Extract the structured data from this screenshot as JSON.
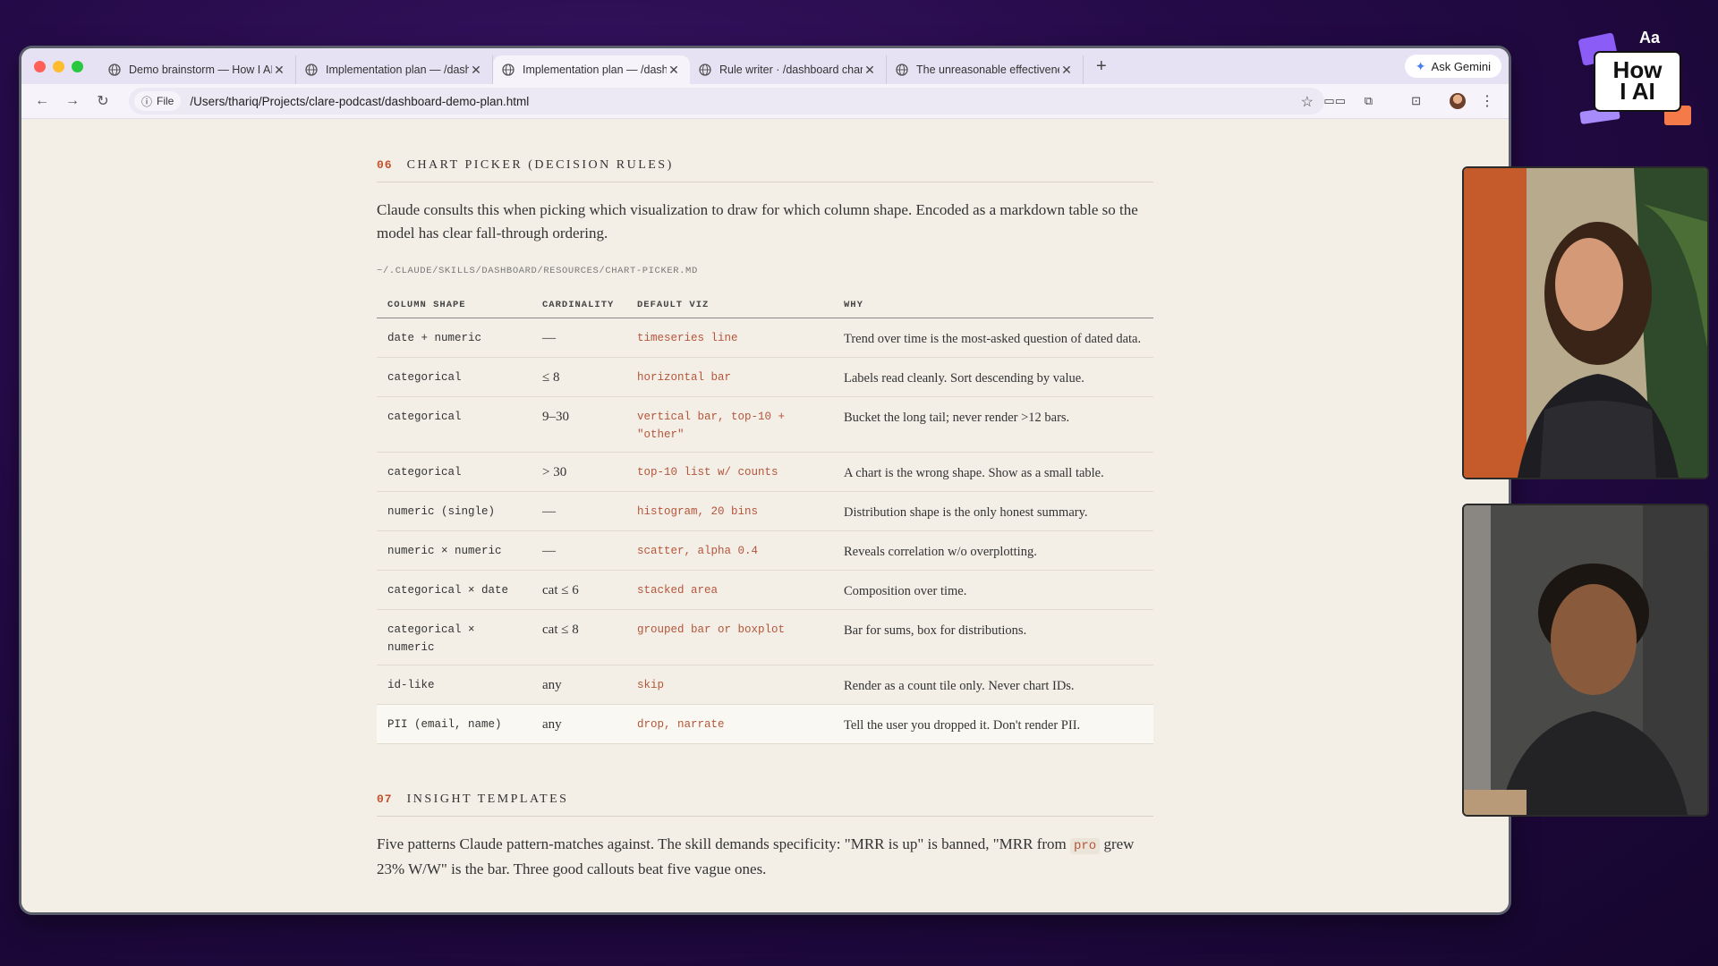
{
  "browser": {
    "tabs": [
      {
        "label": "Demo brainstorm — How I AI",
        "active": false
      },
      {
        "label": "Implementation plan — /dashboard",
        "active": false
      },
      {
        "label": "Implementation plan — /dashboard",
        "active": true
      },
      {
        "label": "Rule writer · /dashboard chart",
        "active": false
      },
      {
        "label": "The unreasonable effectiveness",
        "active": false
      }
    ],
    "new_tab": "+",
    "gemini_label": "Ask Gemini",
    "file_chip": "File",
    "url": "/Users/thariq/Projects/clare-podcast/dashboard-demo-plan.html"
  },
  "section6": {
    "number": "06",
    "title": "CHART PICKER (DECISION RULES)",
    "intro": "Claude consults this when picking which visualization to draw for which column shape. Encoded as a markdown table so the model has clear fall-through ordering.",
    "path": "~/.CLAUDE/SKILLS/DASHBOARD/RESOURCES/CHART-PICKER.MD",
    "headers": {
      "shape": "COLUMN SHAPE",
      "card": "CARDINALITY",
      "viz": "DEFAULT VIZ",
      "why": "WHY"
    },
    "rows": [
      {
        "shape": "date + numeric",
        "card": "—",
        "viz": "timeseries line",
        "why": "Trend over time is the most-asked question of dated data."
      },
      {
        "shape": "categorical",
        "card": "≤ 8",
        "viz": "horizontal bar",
        "why": "Labels read cleanly. Sort descending by value."
      },
      {
        "shape": "categorical",
        "card": "9–30",
        "viz": "vertical bar, top-10 + \"other\"",
        "why": "Bucket the long tail; never render >12 bars."
      },
      {
        "shape": "categorical",
        "card": "> 30",
        "viz": "top-10 list w/ counts",
        "why": "A chart is the wrong shape. Show as a small table."
      },
      {
        "shape": "numeric (single)",
        "card": "—",
        "viz": "histogram, 20 bins",
        "why": "Distribution shape is the only honest summary."
      },
      {
        "shape": "numeric × numeric",
        "card": "—",
        "viz": "scatter, alpha 0.4",
        "why": "Reveals correlation w/o overplotting."
      },
      {
        "shape": "categorical × date",
        "card": "cat ≤ 6",
        "viz": "stacked area",
        "why": "Composition over time."
      },
      {
        "shape": "categorical × numeric",
        "card": "cat ≤ 8",
        "viz": "grouped bar or boxplot",
        "why": "Bar for sums, box for distributions."
      },
      {
        "shape": "id-like",
        "card": "any",
        "viz": "skip",
        "why": "Render as a count tile only. Never chart IDs."
      },
      {
        "shape": "PII (email, name)",
        "card": "any",
        "viz": "drop, narrate",
        "why": "Tell the user you dropped it. Don't render PII."
      }
    ]
  },
  "section7": {
    "number": "07",
    "title": "INSIGHT TEMPLATES",
    "intro_a": "Five patterns Claude pattern-matches against. The skill demands specificity: \"MRR is up\" is banned, \"MRR from ",
    "intro_code": "pro",
    "intro_b": " grew 23% W/W\" is the bar. Three good callouts beat five vague ones."
  },
  "logo": {
    "line1": "How",
    "line2": "I AI",
    "corner": "Aa"
  },
  "colors": {
    "accent": "#c0522e",
    "viz_text": "#b5553a",
    "page_bg": "#f3efe7",
    "backdrop": "#240a47"
  }
}
